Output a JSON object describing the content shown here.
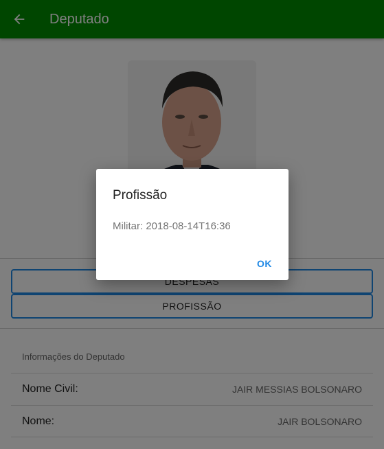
{
  "app_bar": {
    "title": "Deputado",
    "back_icon": "arrow-back-icon",
    "background": "#008c00"
  },
  "actions": {
    "despesas_label": "DESPESAS",
    "profissao_label": "PROFISSÃO",
    "border_color": "#1e88e5"
  },
  "info": {
    "section_title": "Informações do Deputado",
    "rows": [
      {
        "label": "Nome Civil:",
        "value": "JAIR MESSIAS BOLSONARO"
      },
      {
        "label": "Nome:",
        "value": "JAIR BOLSONARO"
      }
    ]
  },
  "dialog": {
    "title": "Profissão",
    "message": "Militar: 2018-08-14T16:36",
    "ok_label": "OK",
    "accent": "#1e88e5"
  }
}
